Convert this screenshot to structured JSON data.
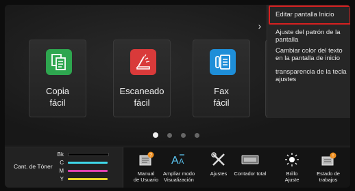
{
  "tiles": [
    {
      "label_1": "Copia",
      "label_2": "fácil",
      "icon": "copy-icon",
      "color": "#2ea64f"
    },
    {
      "label_1": "Escaneado",
      "label_2": "fácil",
      "icon": "scanner-icon",
      "color": "#d93a3a"
    },
    {
      "label_1": "Fax",
      "label_2": "fácil",
      "icon": "fax-icon",
      "color": "#1e8ed8"
    }
  ],
  "menu": {
    "items": [
      {
        "label": "Editar pantalla Inicio"
      },
      {
        "label": "Ajuste del patrón de la pantalla"
      },
      {
        "label": "Cambiar color del texto en la pantalla de inicio"
      },
      {
        "label": "transparencia de la tecla ajustes"
      }
    ],
    "highlight_color": "#d82020"
  },
  "page_dots": {
    "count": 4,
    "active_index": 0
  },
  "toner": {
    "title": "Cant. de Tóner",
    "channels": [
      {
        "name": "Bk",
        "color": "#000000"
      },
      {
        "name": "C",
        "color": "#3fd8ea"
      },
      {
        "name": "M",
        "color": "#e040b0"
      },
      {
        "name": "Y",
        "color": "#e8d42a"
      }
    ]
  },
  "bottom_buttons": [
    {
      "line1": "Manual",
      "line2": "de Usuario",
      "icon": "manual-book-icon"
    },
    {
      "line1": "Ampliar modo",
      "line2": "Visualización",
      "icon": "text-enlarge-icon"
    },
    {
      "line1": "Ajustes",
      "line2": "",
      "icon": "settings-tools-icon"
    },
    {
      "line1": "Contador total",
      "line2": "",
      "icon": "counter-icon"
    },
    {
      "line1": "Brillo",
      "line2": "Ajuste",
      "icon": "brightness-icon"
    },
    {
      "line1": "Estado de",
      "line2": "trabajos",
      "icon": "job-status-icon"
    }
  ],
  "nav": {
    "arrow": "›"
  }
}
